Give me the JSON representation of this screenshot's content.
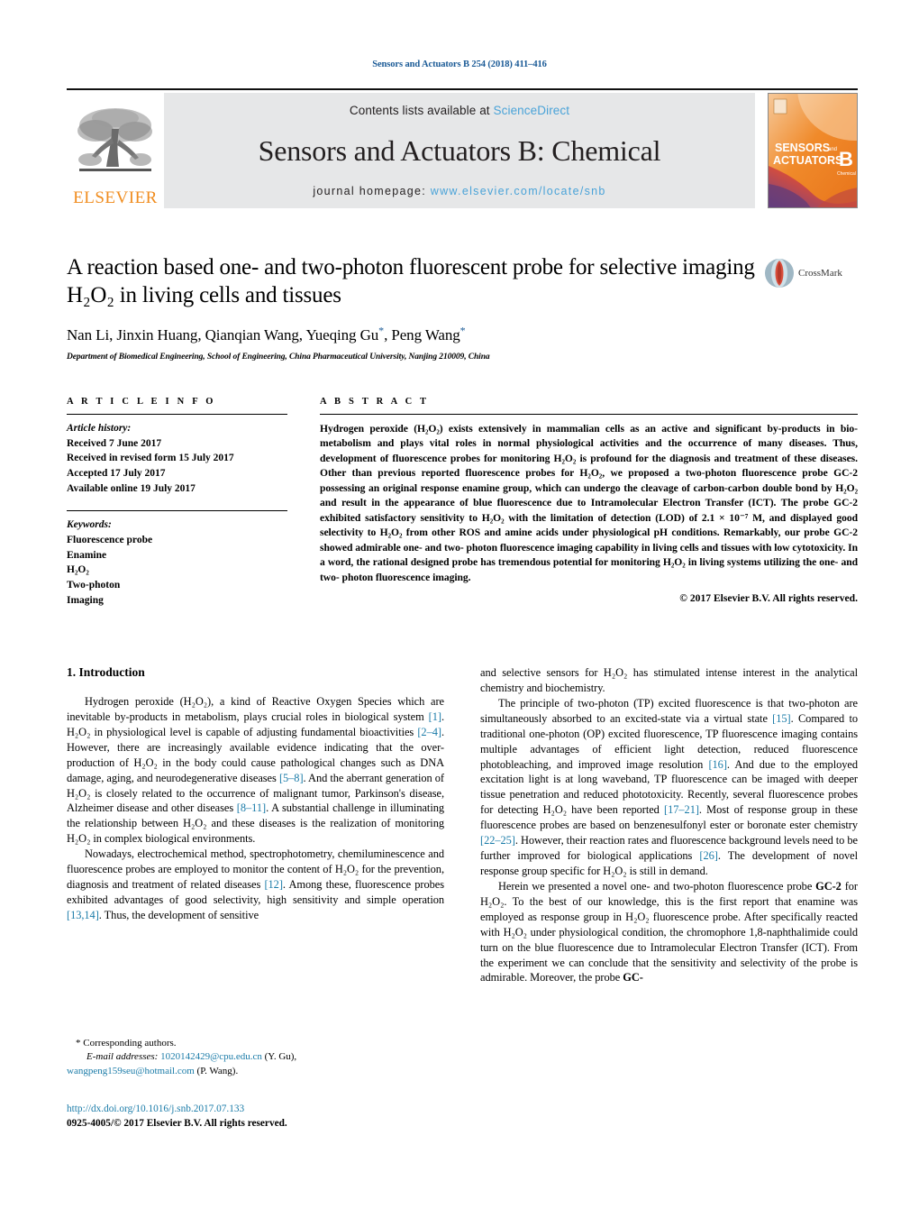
{
  "running_head": "Sensors and Actuators B 254 (2018) 411–416",
  "masthead": {
    "contents_prefix": "Contents lists available at ",
    "contents_link": "ScienceDirect",
    "journal_title": "Sensors and Actuators B: Chemical",
    "homepage_prefix": "journal homepage: ",
    "homepage_url": "www.elsevier.com/locate/snb",
    "publisher": "ELSEVIER",
    "cover_line1": "SENSORS",
    "cover_and": "and",
    "cover_line2": "ACTUATORS",
    "cover_letter": "B",
    "cover_sub": "Chemical",
    "accent_orange": "#f08c1e",
    "link_blue": "#4aa3d8",
    "panel_gray": "#e6e7e8"
  },
  "article": {
    "title": "A reaction based one- and two-photon fluorescent probe for selective imaging H₂O₂ in living cells and tissues",
    "authors": "Nan Li, Jinxin Huang, Qianqian Wang, Yueqing Gu*, Peng Wang*",
    "affiliation": "Department of Biomedical Engineering, School of Engineering, China Pharmaceutical University, Nanjing 210009, China",
    "crossmark_label": "CrossMark"
  },
  "article_info": {
    "heading": "A R T I C L E   I N F O",
    "history_label": "Article history:",
    "history": [
      "Received 7 June 2017",
      "Received in revised form 15 July 2017",
      "Accepted 17 July 2017",
      "Available online 19 July 2017"
    ],
    "keywords_label": "Keywords:",
    "keywords": [
      "Fluorescence probe",
      "Enamine",
      "H₂O₂",
      "Two-photon",
      "Imaging"
    ]
  },
  "abstract": {
    "heading": "A B S T R A C T",
    "text": "Hydrogen peroxide (H₂O₂) exists extensively in mammalian cells as an active and significant by-products in bio-metabolism and plays vital roles in normal physiological activities and the occurrence of many diseases. Thus, development of fluorescence probes for monitoring H₂O₂ is profound for the diagnosis and treatment of these diseases. Other than previous reported fluorescence probes for H₂O₂, we proposed a two-photon fluorescence probe GC-2 possessing an original response enamine group, which can undergo the cleavage of carbon-carbon double bond by H₂O₂ and result in the appearance of blue fluorescence due to Intramolecular Electron Transfer (ICT). The probe GC-2 exhibited satisfactory sensitivity to H₂O₂ with the limitation of detection (LOD) of 2.1 × 10⁻⁷ M, and displayed good selectivity to H₂O₂ from other ROS and amine acids under physiological pH conditions. Remarkably, our probe GC-2 showed admirable one- and two- photon fluorescence imaging capability in living cells and tissues with low cytotoxicity. In a word, the rational designed probe has tremendous potential for monitoring H₂O₂ in living systems utilizing the one- and two- photon fluorescence imaging.",
    "copyright": "© 2017 Elsevier B.V. All rights reserved."
  },
  "body": {
    "section_number_title": "1.  Introduction",
    "left_paragraphs": [
      "Hydrogen peroxide (H₂O₂), a kind of Reactive Oxygen Species which are inevitable by-products in metabolism, plays crucial roles in biological system [1]. H₂O₂ in physiological level is capable of adjusting fundamental bioactivities [2–4]. However, there are increasingly available evidence indicating that the over-production of H₂O₂ in the body could cause pathological changes such as DNA damage, aging, and neurodegenerative diseases [5–8]. And the aberrant generation of H₂O₂ is closely related to the occurrence of malignant tumor, Parkinson's disease, Alzheimer disease and other diseases [8–11]. A substantial challenge in illuminating the relationship between H₂O₂ and these diseases is the realization of monitoring H₂O₂ in complex biological environments.",
      "Nowadays, electrochemical method, spectrophotometry, chemiluminescence and fluorescence probes are employed to monitor the content of H₂O₂ for the prevention, diagnosis and treatment of related diseases [12]. Among these, fluorescence probes exhibited advantages of good selectivity, high sensitivity and simple operation [13,14]. Thus, the development of sensitive"
    ],
    "right_paragraphs": [
      "and selective sensors for H₂O₂ has stimulated intense interest in the analytical chemistry and biochemistry.",
      "The principle of two-photon (TP) excited fluorescence is that two-photon are simultaneously absorbed to an excited-state via a virtual state [15]. Compared to traditional one-photon (OP) excited fluorescence, TP fluorescence imaging contains multiple advantages of efficient light detection, reduced fluorescence photobleaching, and improved image resolution [16]. And due to the employed excitation light is at long waveband, TP fluorescence can be imaged with deeper tissue penetration and reduced phototoxicity. Recently, several fluorescence probes for detecting H₂O₂ have been reported [17–21]. Most of response group in these fluorescence probes are based on benzenesulfonyl ester or boronate ester chemistry [22–25]. However, their reaction rates and fluorescence background levels need to be further improved for biological applications [26]. The development of novel response group specific for H₂O₂ is still in demand.",
      "Herein we presented a novel one- and two-photon fluorescence probe GC-2 for H₂O₂. To the best of our knowledge, this is the first report that enamine was employed as response group in H₂O₂ fluorescence probe. After specifically reacted with H₂O₂ under physiological condition, the chromophore 1,8-naphthalimide could turn on the blue fluorescence due to Intramolecular Electron Transfer (ICT). From the experiment we can conclude that the sensitivity and selectivity of the probe is admirable. Moreover, the probe GC-"
    ]
  },
  "footnotes": {
    "corresponding": "* Corresponding authors.",
    "email_label": "E-mail addresses:",
    "email1": "102014242​9@cpu.edu.cn",
    "email1_name": "(Y. Gu),",
    "email2": "wangpeng159seu@hotmail.com",
    "email2_name": "(P. Wang).",
    "doi": "http://dx.doi.org/10.1016/j.snb.2017.07.133",
    "issn_line": "0925-4005/© 2017 Elsevier B.V. All rights reserved."
  }
}
